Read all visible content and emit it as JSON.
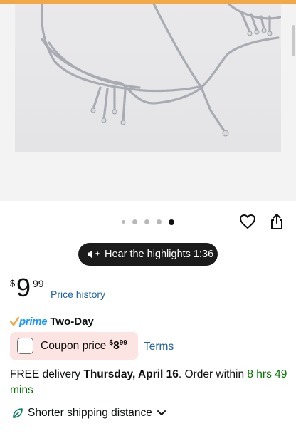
{
  "product_image": {
    "alt": ""
  },
  "carousel": {
    "total": 5,
    "active_index": 4
  },
  "highlights": {
    "label": "Hear the highlights 1:36"
  },
  "price": {
    "currency": "$",
    "dollars": "9",
    "cents": "99",
    "history_link": "Price history"
  },
  "prime": {
    "brand": "prime",
    "label": "Two-Day"
  },
  "coupon": {
    "label": "Coupon price",
    "price_currency": "$",
    "price_dollars": "8",
    "price_cents": "99",
    "terms_link": "Terms"
  },
  "delivery": {
    "prefix": "FREE delivery ",
    "date": "Thursday, April 16",
    "middle": ". Order within ",
    "countdown": "8 hrs 49 mins"
  },
  "shipping": {
    "label": "Shorter shipping distance"
  },
  "colors": {
    "link": "#2162a1",
    "prime_blue": "#1a98ff",
    "prime_check": "#f3a847",
    "coupon_bg": "#fce4e2",
    "countdown_green": "#007600",
    "pill_bg": "#1b1b1b"
  },
  "icons": {
    "wishlist": "heart-icon",
    "share": "share-icon",
    "audio": "speaker-sparkle-icon",
    "eco": "leaf-icon",
    "expand": "chevron-down-icon"
  }
}
